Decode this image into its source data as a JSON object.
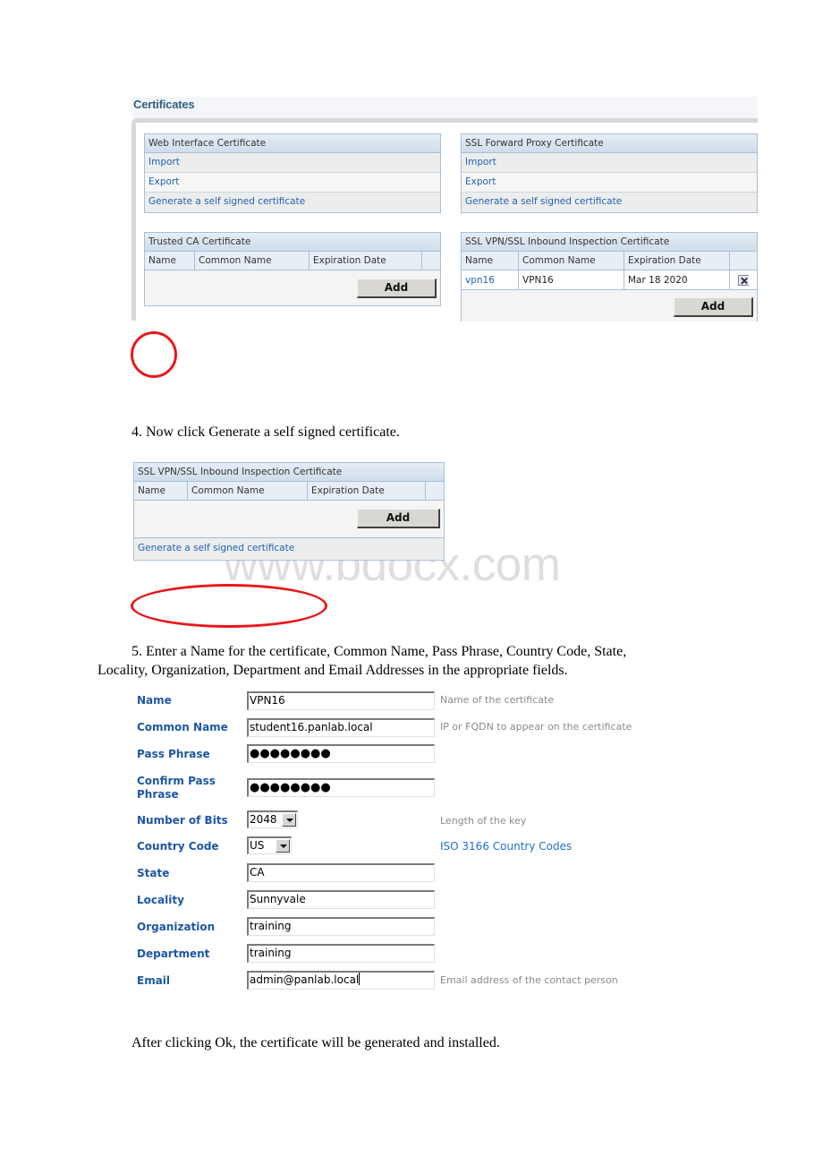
{
  "certificates_screenshot": {
    "title": "Certificates",
    "web_interface": {
      "header": "Web Interface Certificate",
      "links": [
        "Import",
        "Export",
        "Generate a self signed certificate"
      ]
    },
    "ssl_forward_proxy": {
      "header": "SSL Forward Proxy Certificate",
      "links": [
        "Import",
        "Export",
        "Generate a self signed certificate"
      ]
    },
    "trusted_ca": {
      "header": "Trusted CA Certificate",
      "columns": [
        "Name",
        "Common Name",
        "Expiration Date",
        ""
      ],
      "rows": [],
      "add_label": "Add"
    },
    "ssl_vpn_inbound": {
      "header": "SSL VPN/SSL Inbound Inspection Certificate",
      "columns": [
        "Name",
        "Common Name",
        "Expiration Date",
        ""
      ],
      "rows": [
        {
          "name": "vpn16",
          "common_name": "VPN16",
          "expiration_date": "Mar 18 2020",
          "action_icon": "delete-icon"
        }
      ],
      "add_label": "Add"
    }
  },
  "step4": {
    "text": "4. Now click Generate a self signed certificate."
  },
  "inbound_screenshot": {
    "header": "SSL VPN/SSL Inbound Inspection Certificate",
    "columns": [
      "Name",
      "Common Name",
      "Expiration Date",
      ""
    ],
    "add_label": "Add",
    "generate_link": "Generate a self signed certificate"
  },
  "watermark": "www.bdocx.com",
  "step5": {
    "line1": "5. Enter a Name for the certificate, Common Name, Pass Phrase, Country Code, State,",
    "line2": "Locality, Organization, Department and Email Addresses in the appropriate fields."
  },
  "form": {
    "fields": {
      "name": {
        "label": "Name",
        "value": "VPN16",
        "hint": "Name of the certificate"
      },
      "common_name": {
        "label": "Common Name",
        "value": "student16.panlab.local",
        "hint": "IP or FQDN to appear on the certificate"
      },
      "pass_phrase": {
        "label": "Pass Phrase",
        "value": "●●●●●●●●"
      },
      "confirm_pass_phrase": {
        "label_line1": "Confirm Pass",
        "label_line2": "Phrase",
        "value": "●●●●●●●●"
      },
      "number_of_bits": {
        "label": "Number of Bits",
        "value": "2048",
        "hint": "Length of the key"
      },
      "country_code": {
        "label": "Country Code",
        "value": "US",
        "link": "ISO 3166 Country Codes"
      },
      "state": {
        "label": "State",
        "value": "CA"
      },
      "locality": {
        "label": "Locality",
        "value": "Sunnyvale"
      },
      "organization": {
        "label": "Organization",
        "value": "training"
      },
      "department": {
        "label": "Department",
        "value": "training"
      },
      "email": {
        "label": "Email",
        "value": "admin@panlab.local",
        "hint": "Email address of the contact person"
      }
    }
  },
  "closing": {
    "text": "After clicking Ok, the certificate will be generated and installed."
  },
  "colors": {
    "link_blue": "#1f62b8",
    "label_blue": "#1d57a4",
    "annotation_red": "#e8181c",
    "panel_border": "#a9bfd4"
  }
}
